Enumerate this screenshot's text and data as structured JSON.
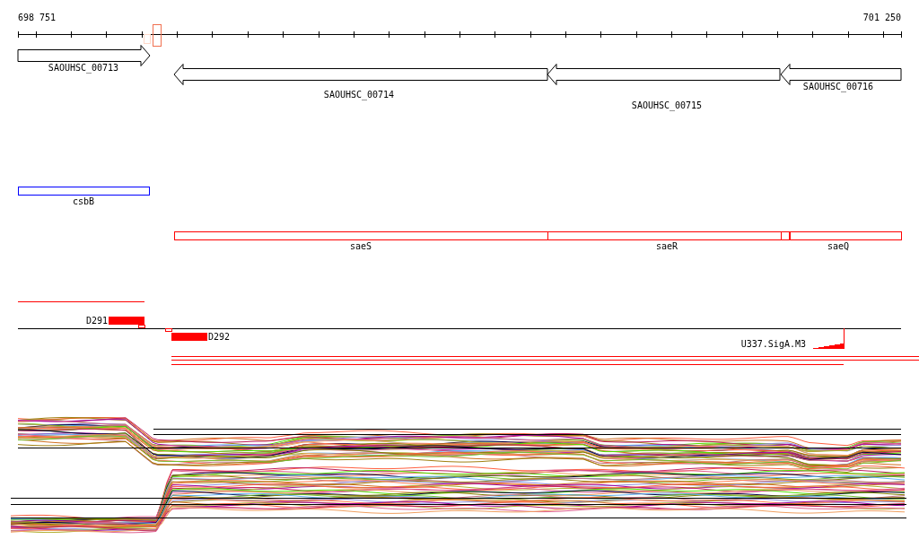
{
  "ruler": {
    "start_label": "698 751",
    "end_label": "701 250"
  },
  "genes": [
    {
      "label": "SAOUHSC_00713",
      "kind": "forward"
    },
    {
      "label": "SAOUHSC_00714",
      "kind": "reverse"
    },
    {
      "label": "SAOUHSC_00715",
      "kind": "reverse"
    },
    {
      "label": "SAOUHSC_00716",
      "kind": "reverse"
    }
  ],
  "annotations": [
    {
      "label": "csbB",
      "color": "#0000ff"
    },
    {
      "label": "saeS",
      "color": "#ff0000"
    },
    {
      "label": "saeR",
      "color": "#ff0000"
    },
    {
      "label": "saeQ",
      "color": "#ff0000"
    }
  ],
  "probes": [
    {
      "label": "D291",
      "kind": "forward"
    },
    {
      "label": "D292",
      "kind": "reverse"
    }
  ],
  "promoters": [
    {
      "label": "U337.SigA.M3"
    }
  ]
}
